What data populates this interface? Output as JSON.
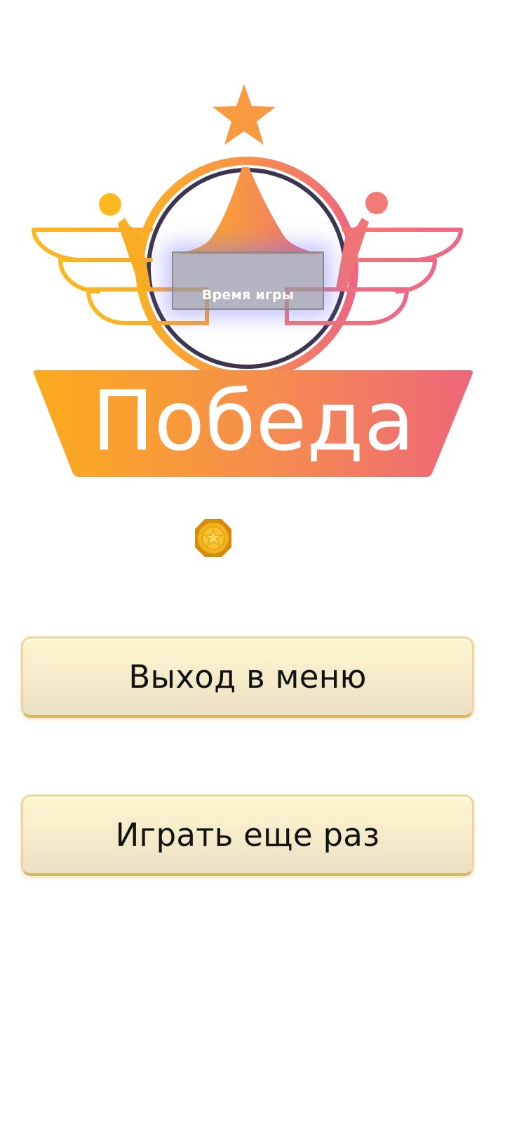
{
  "screen": {
    "title": "Победа",
    "time_label": "Время игры"
  },
  "buttons": {
    "menu_label": "Выход в меню",
    "again_label": "Играть еще раз"
  },
  "icons": {
    "emblem": "winged-badge-icon",
    "top_star": "star-icon",
    "coin": "coin-icon"
  },
  "colors": {
    "gradient_start": "#fbb022",
    "gradient_mid": "#f7924a",
    "gradient_end": "#ee6680",
    "ring_dark": "#3d3550",
    "button_top": "#fdf6cf",
    "button_bottom": "#ebe0c4",
    "coin": "#f2b11d"
  }
}
